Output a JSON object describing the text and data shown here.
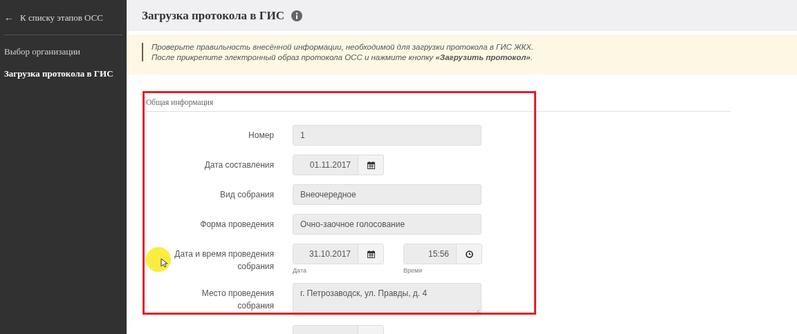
{
  "sidebar": {
    "back_link": {
      "arrow": "←",
      "label": "К списку этапов ОСС"
    },
    "items": [
      {
        "label": "Выбор организации",
        "selected": false
      },
      {
        "label": "Загрузка протокола в ГИС",
        "selected": true
      }
    ]
  },
  "header": {
    "title": "Загрузка протокола в ГИС"
  },
  "notice": {
    "lines": [
      "Проверьте правильность внесённой информации, необходимой для загрузки протокола в ГИС ЖКХ.",
      "После прикрепите электронный образ протокола ОСС и нажмите кнопку **«Загрузить протокол»**."
    ]
  },
  "section": {
    "title": "Общая информация",
    "fields": [
      {
        "kind": "text",
        "label": "Номер",
        "value": "1"
      },
      {
        "kind": "date",
        "label": "Дата составления",
        "value": "01.11.2017"
      },
      {
        "kind": "text",
        "label": "Вид собрания",
        "value": "Внеочередное"
      },
      {
        "kind": "text",
        "label": "Форма проведения",
        "value": "Очно-заочное голосование"
      },
      {
        "kind": "datetime",
        "label": "Дата и время проведения собрания",
        "value": "31.10.2017",
        "hint": "Дата",
        "time": "15:56",
        "time_hint": "Время"
      },
      {
        "kind": "textarea",
        "label": "Место проведения собрания",
        "value": "г. Петрозаводск, ул. Правды, д. 4"
      },
      {
        "kind": "partial"
      }
    ]
  }
}
